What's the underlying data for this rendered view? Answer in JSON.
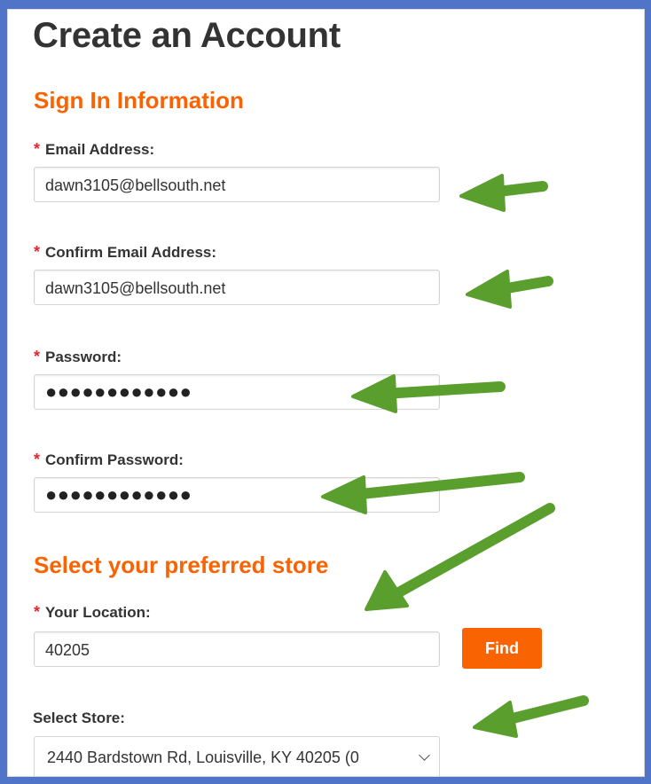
{
  "page_title": "Create an Account",
  "sign_in": {
    "heading": "Sign In Information",
    "required_marker": "*",
    "email_label": "Email Address:",
    "email_value": "dawn3105@bellsouth.net",
    "confirm_email_label": "Confirm Email Address:",
    "confirm_email_value": "dawn3105@bellsouth.net",
    "password_label": "Password:",
    "password_value": "●●●●●●●●●●●●",
    "confirm_password_label": "Confirm Password:",
    "confirm_password_value": "●●●●●●●●●●●●"
  },
  "store": {
    "heading": "Select your preferred store",
    "location_label": "Your Location:",
    "location_value": "40205",
    "find_label": "Find",
    "select_label": "Select Store:",
    "selected_store": "2440 Bardstown Rd, Louisville, KY 40205 (0"
  },
  "colors": {
    "accent": "#f96302",
    "required": "#e3262f",
    "arrow": "#5a9e2e",
    "frame": "#4f74c8"
  },
  "icons": {
    "annotation": "green-arrow-icon",
    "dropdown": "chevron-down-icon"
  }
}
